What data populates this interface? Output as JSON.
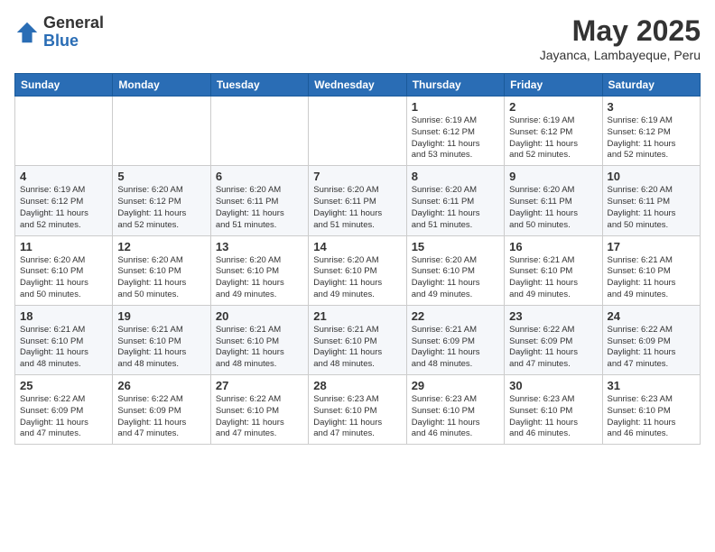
{
  "header": {
    "logo_general": "General",
    "logo_blue": "Blue",
    "month_title": "May 2025",
    "location": "Jayanca, Lambayeque, Peru"
  },
  "days_of_week": [
    "Sunday",
    "Monday",
    "Tuesday",
    "Wednesday",
    "Thursday",
    "Friday",
    "Saturday"
  ],
  "weeks": [
    [
      {
        "day": "",
        "info": ""
      },
      {
        "day": "",
        "info": ""
      },
      {
        "day": "",
        "info": ""
      },
      {
        "day": "",
        "info": ""
      },
      {
        "day": "1",
        "info": "Sunrise: 6:19 AM\nSunset: 6:12 PM\nDaylight: 11 hours\nand 53 minutes."
      },
      {
        "day": "2",
        "info": "Sunrise: 6:19 AM\nSunset: 6:12 PM\nDaylight: 11 hours\nand 52 minutes."
      },
      {
        "day": "3",
        "info": "Sunrise: 6:19 AM\nSunset: 6:12 PM\nDaylight: 11 hours\nand 52 minutes."
      }
    ],
    [
      {
        "day": "4",
        "info": "Sunrise: 6:19 AM\nSunset: 6:12 PM\nDaylight: 11 hours\nand 52 minutes."
      },
      {
        "day": "5",
        "info": "Sunrise: 6:20 AM\nSunset: 6:12 PM\nDaylight: 11 hours\nand 52 minutes."
      },
      {
        "day": "6",
        "info": "Sunrise: 6:20 AM\nSunset: 6:11 PM\nDaylight: 11 hours\nand 51 minutes."
      },
      {
        "day": "7",
        "info": "Sunrise: 6:20 AM\nSunset: 6:11 PM\nDaylight: 11 hours\nand 51 minutes."
      },
      {
        "day": "8",
        "info": "Sunrise: 6:20 AM\nSunset: 6:11 PM\nDaylight: 11 hours\nand 51 minutes."
      },
      {
        "day": "9",
        "info": "Sunrise: 6:20 AM\nSunset: 6:11 PM\nDaylight: 11 hours\nand 50 minutes."
      },
      {
        "day": "10",
        "info": "Sunrise: 6:20 AM\nSunset: 6:11 PM\nDaylight: 11 hours\nand 50 minutes."
      }
    ],
    [
      {
        "day": "11",
        "info": "Sunrise: 6:20 AM\nSunset: 6:10 PM\nDaylight: 11 hours\nand 50 minutes."
      },
      {
        "day": "12",
        "info": "Sunrise: 6:20 AM\nSunset: 6:10 PM\nDaylight: 11 hours\nand 50 minutes."
      },
      {
        "day": "13",
        "info": "Sunrise: 6:20 AM\nSunset: 6:10 PM\nDaylight: 11 hours\nand 49 minutes."
      },
      {
        "day": "14",
        "info": "Sunrise: 6:20 AM\nSunset: 6:10 PM\nDaylight: 11 hours\nand 49 minutes."
      },
      {
        "day": "15",
        "info": "Sunrise: 6:20 AM\nSunset: 6:10 PM\nDaylight: 11 hours\nand 49 minutes."
      },
      {
        "day": "16",
        "info": "Sunrise: 6:21 AM\nSunset: 6:10 PM\nDaylight: 11 hours\nand 49 minutes."
      },
      {
        "day": "17",
        "info": "Sunrise: 6:21 AM\nSunset: 6:10 PM\nDaylight: 11 hours\nand 49 minutes."
      }
    ],
    [
      {
        "day": "18",
        "info": "Sunrise: 6:21 AM\nSunset: 6:10 PM\nDaylight: 11 hours\nand 48 minutes."
      },
      {
        "day": "19",
        "info": "Sunrise: 6:21 AM\nSunset: 6:10 PM\nDaylight: 11 hours\nand 48 minutes."
      },
      {
        "day": "20",
        "info": "Sunrise: 6:21 AM\nSunset: 6:10 PM\nDaylight: 11 hours\nand 48 minutes."
      },
      {
        "day": "21",
        "info": "Sunrise: 6:21 AM\nSunset: 6:10 PM\nDaylight: 11 hours\nand 48 minutes."
      },
      {
        "day": "22",
        "info": "Sunrise: 6:21 AM\nSunset: 6:09 PM\nDaylight: 11 hours\nand 48 minutes."
      },
      {
        "day": "23",
        "info": "Sunrise: 6:22 AM\nSunset: 6:09 PM\nDaylight: 11 hours\nand 47 minutes."
      },
      {
        "day": "24",
        "info": "Sunrise: 6:22 AM\nSunset: 6:09 PM\nDaylight: 11 hours\nand 47 minutes."
      }
    ],
    [
      {
        "day": "25",
        "info": "Sunrise: 6:22 AM\nSunset: 6:09 PM\nDaylight: 11 hours\nand 47 minutes."
      },
      {
        "day": "26",
        "info": "Sunrise: 6:22 AM\nSunset: 6:09 PM\nDaylight: 11 hours\nand 47 minutes."
      },
      {
        "day": "27",
        "info": "Sunrise: 6:22 AM\nSunset: 6:10 PM\nDaylight: 11 hours\nand 47 minutes."
      },
      {
        "day": "28",
        "info": "Sunrise: 6:23 AM\nSunset: 6:10 PM\nDaylight: 11 hours\nand 47 minutes."
      },
      {
        "day": "29",
        "info": "Sunrise: 6:23 AM\nSunset: 6:10 PM\nDaylight: 11 hours\nand 46 minutes."
      },
      {
        "day": "30",
        "info": "Sunrise: 6:23 AM\nSunset: 6:10 PM\nDaylight: 11 hours\nand 46 minutes."
      },
      {
        "day": "31",
        "info": "Sunrise: 6:23 AM\nSunset: 6:10 PM\nDaylight: 11 hours\nand 46 minutes."
      }
    ]
  ]
}
